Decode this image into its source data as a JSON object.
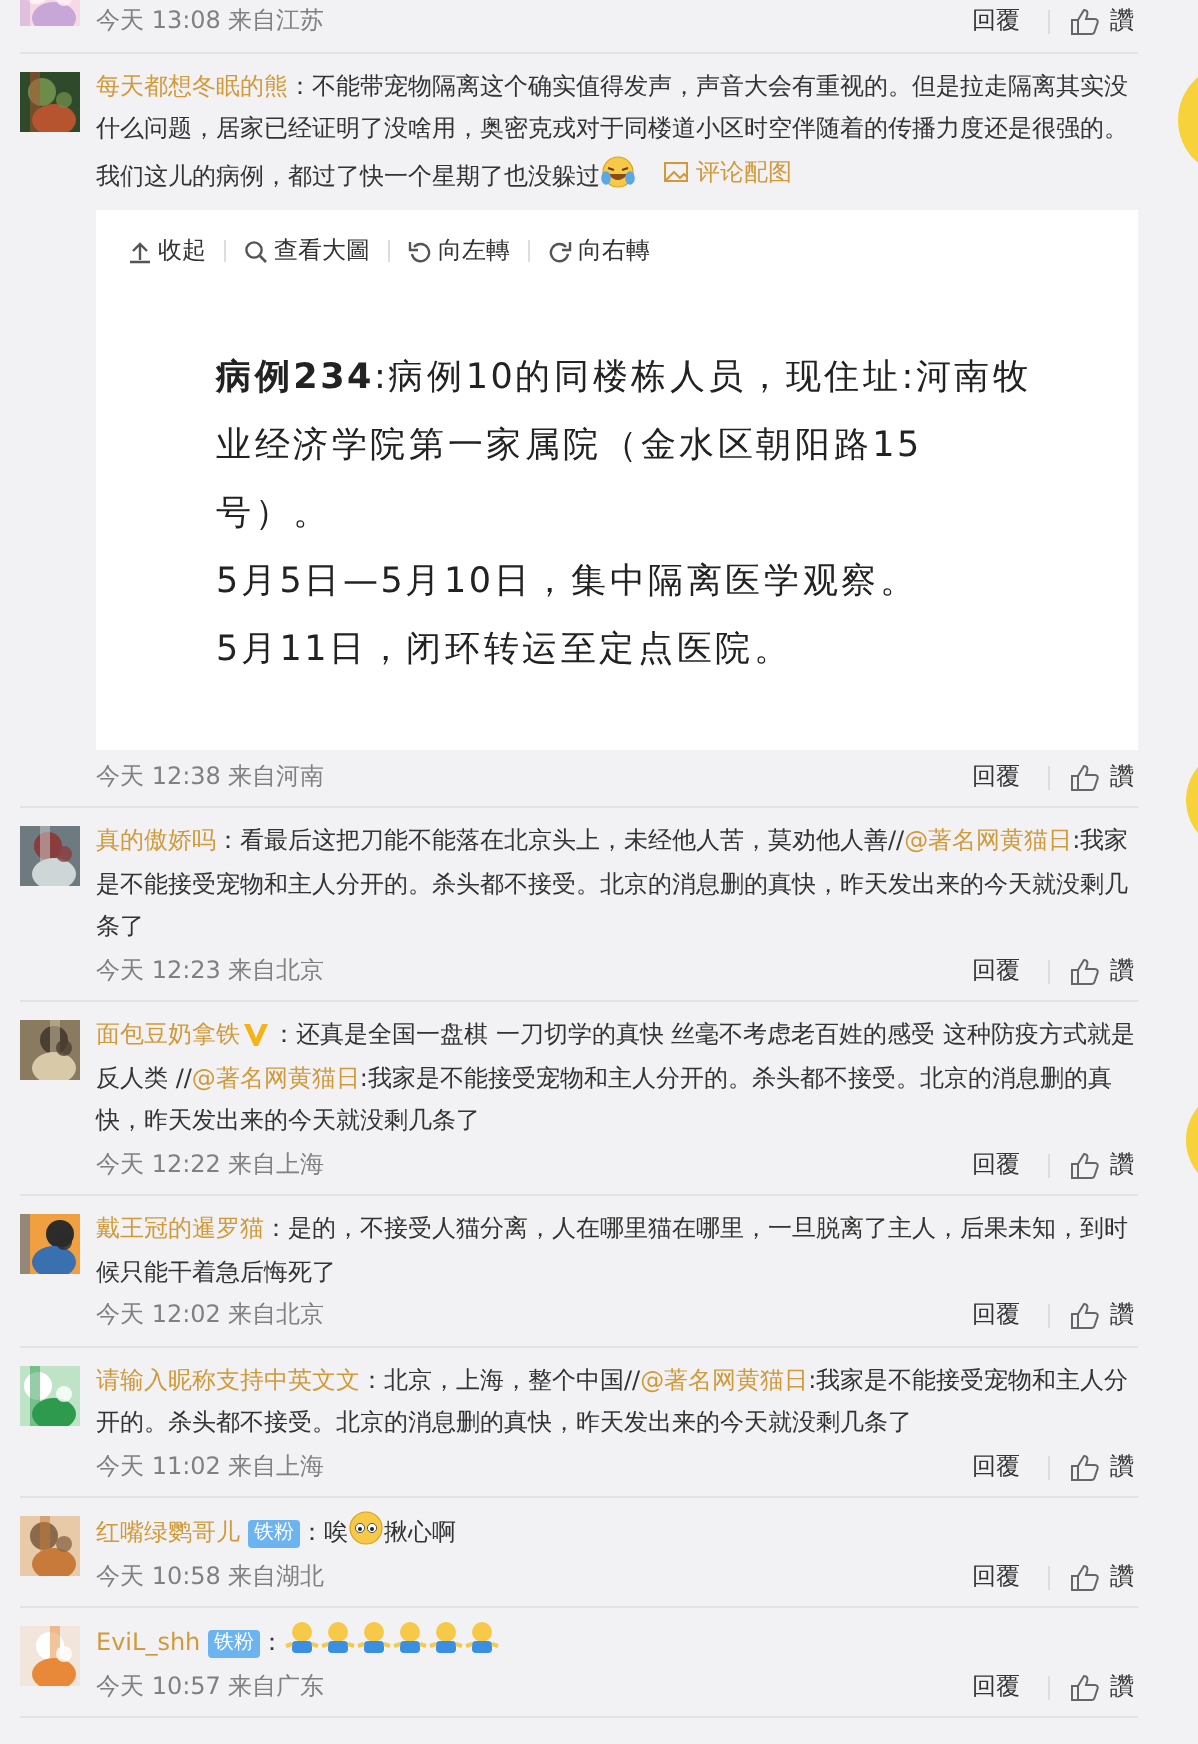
{
  "comments": [
    {
      "meta": "今天 13:08 来自江苏",
      "reply": "回覆",
      "like": "讚"
    },
    {
      "user": "每天都想冬眠的熊",
      "segments": [
        {
          "kind": "text",
          "text": "：不能带宠物隔离这个确实值得发声，声音大会有重视的。但是拉走隔离其实没什么问题，居家已经证明了没啥用，奥密克戎对于同楼道小区时空伴随着的传播力度还是很强的。我们这儿的病例，都过了快一个星期了也没躲过"
        },
        {
          "kind": "laughing-emoji"
        }
      ],
      "image_link": "评论配图",
      "viewer": {
        "toolbar": [
          "收起",
          "查看大圖",
          "向左轉",
          "向右轉"
        ],
        "paragraphs": [
          "**病例234**:病例10的同楼栋人员，现住址:河南牧业经济学院第一家属院（金水区朝阳路15号）。",
          "5月5日—5月10日，集中隔离医学观察。",
          "5月11日，闭环转运至定点医院。"
        ]
      },
      "meta": "今天 12:38 来自河南",
      "reply": "回覆",
      "like": "讚"
    },
    {
      "user": "真的傲娇吗",
      "segments": [
        {
          "kind": "text",
          "text": "：看最后这把刀能不能落在北京头上，未经他人苦，莫劝他人善//"
        },
        {
          "kind": "mention",
          "text": "@著名网黄猫日"
        },
        {
          "kind": "text",
          "text": ":我家是不能接受宠物和主人分开的。杀头都不接受。北京的消息删的真快，昨天发出来的今天就没剩几条了"
        }
      ],
      "meta": "今天 12:23 来自北京",
      "reply": "回覆",
      "like": "讚"
    },
    {
      "user": "面包豆奶拿铁",
      "verified": true,
      "segments": [
        {
          "kind": "text",
          "text": "：还真是全国一盘棋 一刀切学的真快 丝毫不考虑老百姓的感受 这种防疫方式就是反人类 //"
        },
        {
          "kind": "mention",
          "text": "@著名网黄猫日"
        },
        {
          "kind": "text",
          "text": ":我家是不能接受宠物和主人分开的。杀头都不接受。北京的消息删的真快，昨天发出来的今天就没剩几条了"
        }
      ],
      "meta": "今天 12:22 来自上海",
      "reply": "回覆",
      "like": "讚"
    },
    {
      "user": "戴王冠的暹罗猫",
      "segments": [
        {
          "kind": "text",
          "text": "：是的，不接受人猫分离，人在哪里猫在哪里，一旦脱离了主人，后果未知，到时候只能干着急后悔死了"
        }
      ],
      "meta": "今天 12:02 来自北京",
      "reply": "回覆",
      "like": "讚"
    },
    {
      "user": "请输入昵称支持中英文文",
      "segments": [
        {
          "kind": "text",
          "text": "：北京，上海，整个中国//"
        },
        {
          "kind": "mention",
          "text": "@著名网黄猫日"
        },
        {
          "kind": "text",
          "text": ":我家是不能接受宠物和主人分开的。杀头都不接受。北京的消息删的真快，昨天发出来的今天就没剩几条了"
        }
      ],
      "meta": "今天 11:02 来自上海",
      "reply": "回覆",
      "like": "讚"
    },
    {
      "user": "红嘴绿鹦哥儿",
      "badge": "铁粉",
      "segments": [
        {
          "kind": "text",
          "text": "：唉"
        },
        {
          "kind": "face-emoji"
        },
        {
          "kind": "text",
          "text": "揪心啊"
        }
      ],
      "meta": "今天 10:58 来自湖北",
      "reply": "回覆",
      "like": "讚"
    },
    {
      "user": "EviL_shh",
      "badge": "铁粉",
      "segments": [
        {
          "kind": "text",
          "text": "："
        },
        {
          "kind": "figure-emoji"
        },
        {
          "kind": "figure-emoji"
        },
        {
          "kind": "figure-emoji"
        },
        {
          "kind": "figure-emoji"
        },
        {
          "kind": "figure-emoji"
        },
        {
          "kind": "figure-emoji"
        }
      ],
      "meta": "今天 10:57 来自广东",
      "reply": "回覆",
      "like": "讚"
    }
  ]
}
